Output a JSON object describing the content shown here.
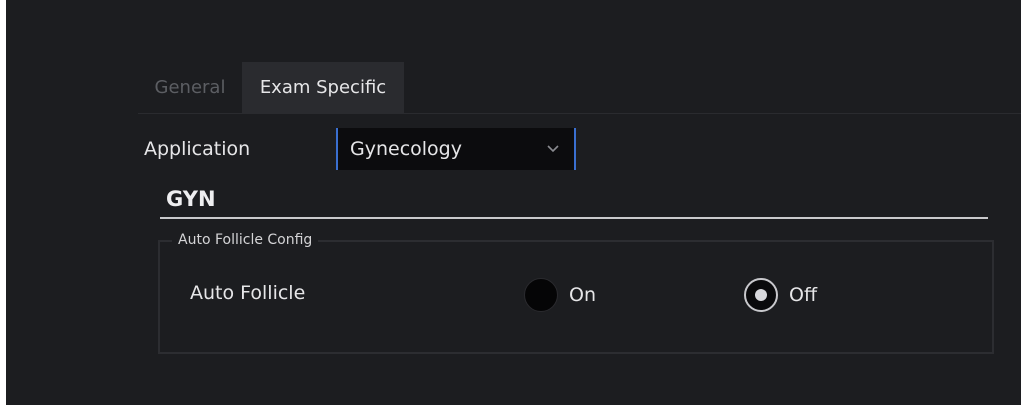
{
  "tabs": [
    {
      "label": "General",
      "active": false
    },
    {
      "label": "Exam Specific",
      "active": true
    }
  ],
  "application": {
    "label": "Application",
    "selected": "Gynecology",
    "chevron_icon": "chevron-down-icon"
  },
  "section": {
    "title": "GYN"
  },
  "group": {
    "legend": "Auto Follicle Config",
    "setting_label": "Auto Follicle",
    "options": [
      {
        "label": "On",
        "selected": false
      },
      {
        "label": "Off",
        "selected": true
      }
    ]
  },
  "colors": {
    "background": "#1c1d20",
    "active_tab": "#2a2b2f",
    "accent": "#3a6fd0",
    "text": "#e6e6e8",
    "inactive_text": "#5c5e63"
  }
}
